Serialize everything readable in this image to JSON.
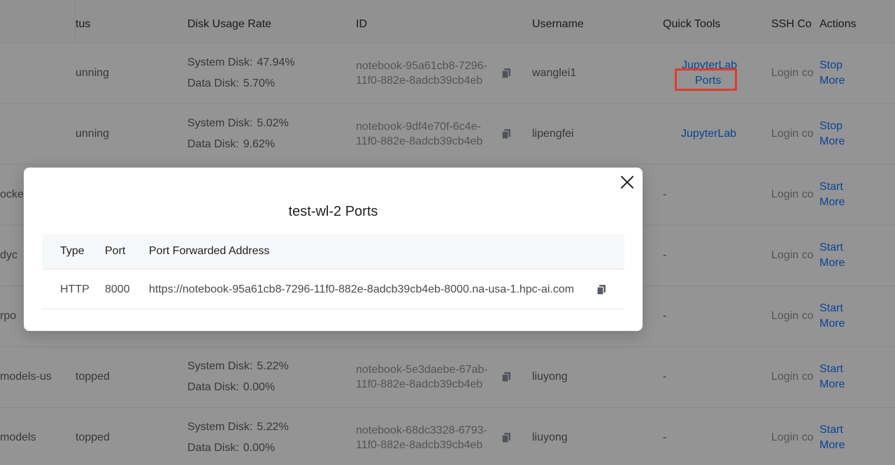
{
  "table": {
    "headers": {
      "status": "tus",
      "disk": "Disk Usage Rate",
      "id": "ID",
      "username": "Username",
      "quick_tools": "Quick Tools",
      "ssh": "SSH Co",
      "actions": "Actions"
    },
    "disk_labels": {
      "system": "System Disk:",
      "data": "Data Disk:"
    },
    "rows": [
      {
        "name": "",
        "status": "unning",
        "system_disk": "47.94%",
        "data_disk": "5.70%",
        "id_line1": "notebook-95a61cb8-7296-",
        "id_line2": "11f0-882e-8adcb39cb4eb",
        "username": "wanglei1",
        "tool1": "JupyterLab",
        "tool2": "Ports",
        "ssh": "Login co",
        "action1": "Stop",
        "action2": "More"
      },
      {
        "name": "",
        "status": "unning",
        "system_disk": "5.02%",
        "data_disk": "9.62%",
        "id_line1": "notebook-9df4e70f-6c4e-",
        "id_line2": "11f0-882e-8adcb39cb4eb",
        "username": "lipengfei",
        "tool1": "JupyterLab",
        "ssh": "Login co",
        "action1": "Stop",
        "action2": "More"
      },
      {
        "name": "ocker",
        "status": "",
        "tool1": "-",
        "ssh": "Login co",
        "action1": "Start",
        "action2": "More"
      },
      {
        "name": "dyc",
        "status": "",
        "tool1": "-",
        "ssh": "Login co",
        "action1": "Start",
        "action2": "More"
      },
      {
        "name": "rpo",
        "status": "",
        "tool1": "-",
        "ssh": "Login co",
        "action1": "Start",
        "action2": "More"
      },
      {
        "name": "models-us",
        "status": "topped",
        "system_disk": "5.22%",
        "data_disk": "0.00%",
        "id_line1": "notebook-5e3daebe-67ab-",
        "id_line2": "11f0-882e-8adcb39cb4eb",
        "username": "liuyong",
        "tool1": "-",
        "ssh": "Login co",
        "action1": "Start",
        "action2": "More"
      },
      {
        "name": "models",
        "status": "topped",
        "system_disk": "5.22%",
        "data_disk": "0.00%",
        "id_line1": "notebook-68dc3328-6793-",
        "id_line2": "11f0-882e-8adcb39cb4eb",
        "username": "liuyong",
        "tool1": "-",
        "ssh": "Login co",
        "action1": "Start",
        "action2": "More"
      }
    ]
  },
  "modal": {
    "title": "test-wl-2 Ports",
    "close_icon": "close-icon",
    "columns": [
      "Type",
      "Port",
      "Port Forwarded Address"
    ],
    "rows": [
      {
        "type": "HTTP",
        "port": "8000",
        "address": "https://notebook-95a61cb8-7296-11f0-882e-8adcb39cb4eb-8000.na-usa-1.hpc-ai.com"
      }
    ]
  },
  "colors": {
    "link": "#1677ff",
    "highlight": "#e23b2e",
    "overlay": "rgba(0,0,0,0.42)"
  }
}
